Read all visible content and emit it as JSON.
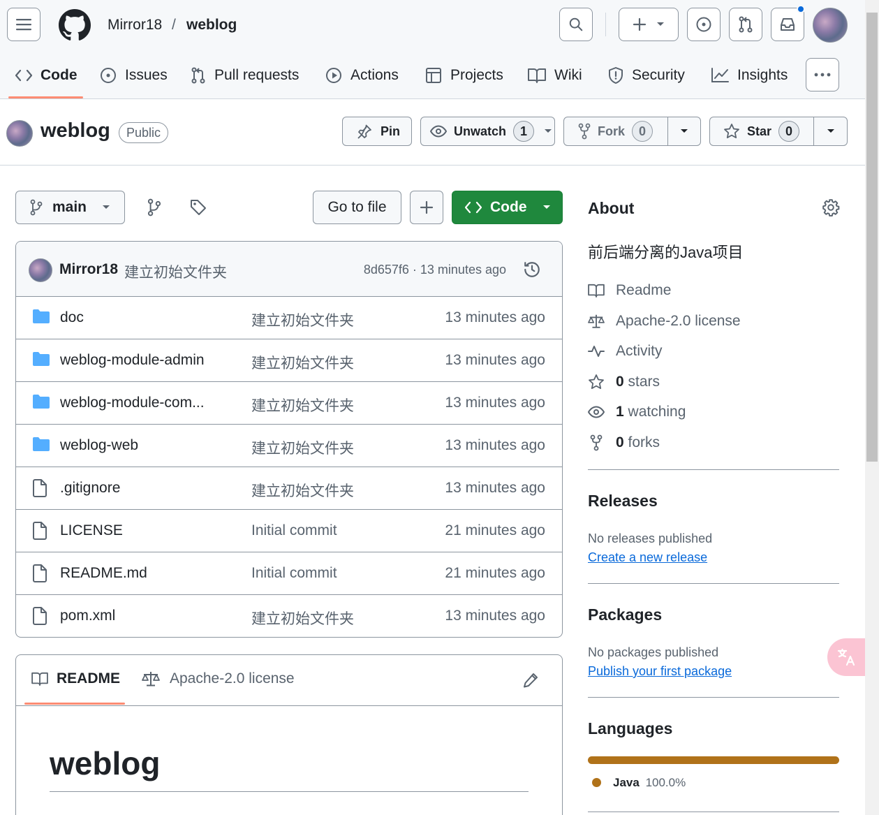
{
  "header": {
    "owner": "Mirror18",
    "separator": "/",
    "repo": "weblog"
  },
  "tabs": [
    {
      "label": "Code",
      "icon": "code-icon",
      "selected": true
    },
    {
      "label": "Issues",
      "icon": "issue-icon"
    },
    {
      "label": "Pull requests",
      "icon": "pull-request-icon"
    },
    {
      "label": "Actions",
      "icon": "play-icon"
    },
    {
      "label": "Projects",
      "icon": "table-icon"
    },
    {
      "label": "Wiki",
      "icon": "book-icon"
    },
    {
      "label": "Security",
      "icon": "shield-icon"
    },
    {
      "label": "Insights",
      "icon": "graph-icon"
    }
  ],
  "repo": {
    "title": "weblog",
    "visibility": "Public",
    "pin_label": "Pin",
    "unwatch_label": "Unwatch",
    "watch_count": "1",
    "fork_label": "Fork",
    "fork_count": "0",
    "star_label": "Star",
    "star_count": "0"
  },
  "branch": {
    "name": "main",
    "go_to_file": "Go to file",
    "code_label": "Code"
  },
  "commit": {
    "author": "Mirror18",
    "message": "建立初始文件夹",
    "hash_time": "8d657f6 · 13 minutes ago"
  },
  "files": [
    {
      "name": "doc",
      "type": "folder",
      "message": "建立初始文件夹",
      "time": "13 minutes ago"
    },
    {
      "name": "weblog-module-admin",
      "type": "folder",
      "message": "建立初始文件夹",
      "time": "13 minutes ago"
    },
    {
      "name": "weblog-module-com...",
      "type": "folder",
      "message": "建立初始文件夹",
      "time": "13 minutes ago"
    },
    {
      "name": "weblog-web",
      "type": "folder",
      "message": "建立初始文件夹",
      "time": "13 minutes ago"
    },
    {
      "name": ".gitignore",
      "type": "file",
      "message": "建立初始文件夹",
      "time": "13 minutes ago"
    },
    {
      "name": "LICENSE",
      "type": "file",
      "message": "Initial commit",
      "time": "21 minutes ago"
    },
    {
      "name": "README.md",
      "type": "file",
      "message": "Initial commit",
      "time": "21 minutes ago"
    },
    {
      "name": "pom.xml",
      "type": "file",
      "message": "建立初始文件夹",
      "time": "13 minutes ago"
    }
  ],
  "readme": {
    "tab_readme": "README",
    "tab_license": "Apache-2.0 license",
    "heading": "weblog"
  },
  "about": {
    "heading": "About",
    "description": "前后端分离的Java项目",
    "items": [
      {
        "icon": "book-icon",
        "label": "Readme"
      },
      {
        "icon": "law-icon",
        "label": "Apache-2.0 license"
      },
      {
        "icon": "pulse-icon",
        "label": "Activity"
      },
      {
        "icon": "star-icon",
        "count": "0",
        "label": " stars"
      },
      {
        "icon": "eye-icon",
        "count": "1",
        "label": " watching"
      },
      {
        "icon": "fork-icon",
        "count": "0",
        "label": " forks"
      }
    ]
  },
  "releases": {
    "heading": "Releases",
    "empty": "No releases published",
    "link": "Create a new release"
  },
  "packages": {
    "heading": "Packages",
    "empty": "No packages published",
    "link": "Publish your first package"
  },
  "languages": {
    "heading": "Languages",
    "items": [
      {
        "name": "Java",
        "percent": "100.0%",
        "color": "#b07219"
      }
    ]
  },
  "colors": {
    "accent": "#0969da",
    "code_button": "#1f883d",
    "tab_underline": "#fd8c73",
    "folder": "#54aeff"
  }
}
